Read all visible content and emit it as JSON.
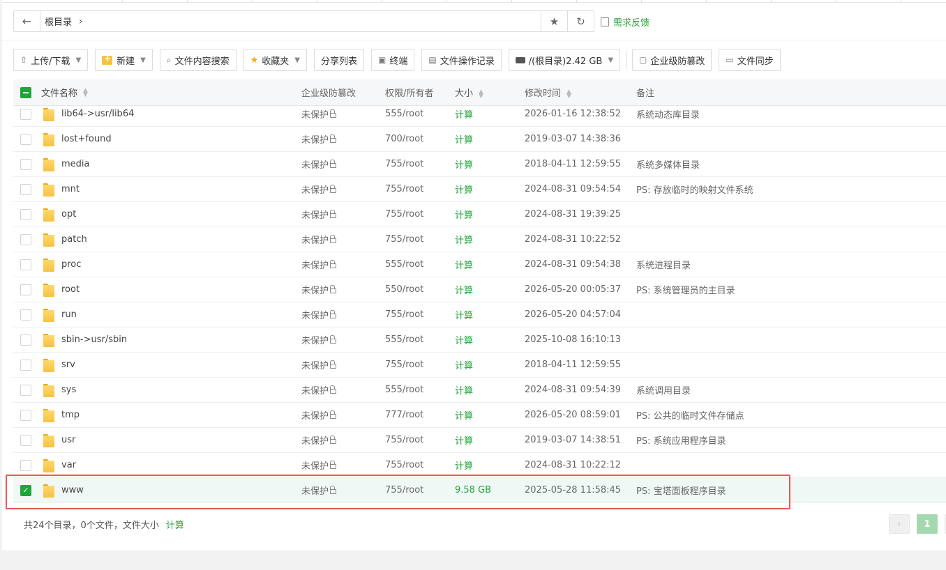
{
  "address": {
    "path_root": "根目录",
    "feedback_label": "需求反馈"
  },
  "toolbar": {
    "upload_download": "上传/下载",
    "new": "新建",
    "content_search": "文件内容搜索",
    "favorites": "收藏夹",
    "share_list": "分享列表",
    "terminal": "终端",
    "op_log": "文件操作记录",
    "disk": "/(根目录)2.42 GB",
    "tamper_proof": "企业级防篡改",
    "file_sync": "文件同步"
  },
  "table": {
    "headers": {
      "name": "文件名称",
      "protection": "企业级防篡改",
      "perm": "权限/所有者",
      "size": "大小",
      "mtime": "修改时间",
      "note": "备注"
    },
    "rows": [
      {
        "name": "lib64->usr/lib64",
        "prot": "未保护",
        "perm": "555/root",
        "size": "计算",
        "time": "2026-01-16 12:38:52",
        "note": "系统动态库目录"
      },
      {
        "name": "lost+found",
        "prot": "未保护",
        "perm": "700/root",
        "size": "计算",
        "time": "2019-03-07 14:38:36",
        "note": ""
      },
      {
        "name": "media",
        "prot": "未保护",
        "perm": "755/root",
        "size": "计算",
        "time": "2018-04-11 12:59:55",
        "note": "系统多媒体目录"
      },
      {
        "name": "mnt",
        "prot": "未保护",
        "perm": "755/root",
        "size": "计算",
        "time": "2024-08-31 09:54:54",
        "note": "PS: 存放临时的映射文件系统"
      },
      {
        "name": "opt",
        "prot": "未保护",
        "perm": "755/root",
        "size": "计算",
        "time": "2024-08-31 19:39:25",
        "note": ""
      },
      {
        "name": "patch",
        "prot": "未保护",
        "perm": "755/root",
        "size": "计算",
        "time": "2024-08-31 10:22:52",
        "note": ""
      },
      {
        "name": "proc",
        "prot": "未保护",
        "perm": "555/root",
        "size": "计算",
        "time": "2024-08-31 09:54:38",
        "note": "系统进程目录"
      },
      {
        "name": "root",
        "prot": "未保护",
        "perm": "550/root",
        "size": "计算",
        "time": "2026-05-20 00:05:37",
        "note": "PS: 系统管理员的主目录"
      },
      {
        "name": "run",
        "prot": "未保护",
        "perm": "755/root",
        "size": "计算",
        "time": "2026-05-20 04:57:04",
        "note": ""
      },
      {
        "name": "sbin->usr/sbin",
        "prot": "未保护",
        "perm": "555/root",
        "size": "计算",
        "time": "2025-10-08 16:10:13",
        "note": ""
      },
      {
        "name": "srv",
        "prot": "未保护",
        "perm": "755/root",
        "size": "计算",
        "time": "2018-04-11 12:59:55",
        "note": ""
      },
      {
        "name": "sys",
        "prot": "未保护",
        "perm": "555/root",
        "size": "计算",
        "time": "2024-08-31 09:54:39",
        "note": "系统调用目录"
      },
      {
        "name": "tmp",
        "prot": "未保护",
        "perm": "777/root",
        "size": "计算",
        "time": "2026-05-20 08:59:01",
        "note": "PS: 公共的临时文件存储点"
      },
      {
        "name": "usr",
        "prot": "未保护",
        "perm": "755/root",
        "size": "计算",
        "time": "2019-03-07 14:38:51",
        "note": "PS: 系统应用程序目录"
      },
      {
        "name": "var",
        "prot": "未保护",
        "perm": "755/root",
        "size": "计算",
        "time": "2024-08-31 10:22:12",
        "note": ""
      },
      {
        "name": "www",
        "prot": "未保护",
        "perm": "755/root",
        "size": "9.58 GB",
        "time": "2025-05-28 11:58:45",
        "note": "PS: 宝塔面板程序目录",
        "selected": true
      }
    ]
  },
  "footer": {
    "summary": "共24个目录，0个文件，文件大小",
    "calc": "计算",
    "prev": "‹",
    "current_page": "1"
  },
  "colors": {
    "accent": "#20a53a",
    "highlight_border": "#e55a58",
    "selected_row": "#f0f8f6"
  }
}
